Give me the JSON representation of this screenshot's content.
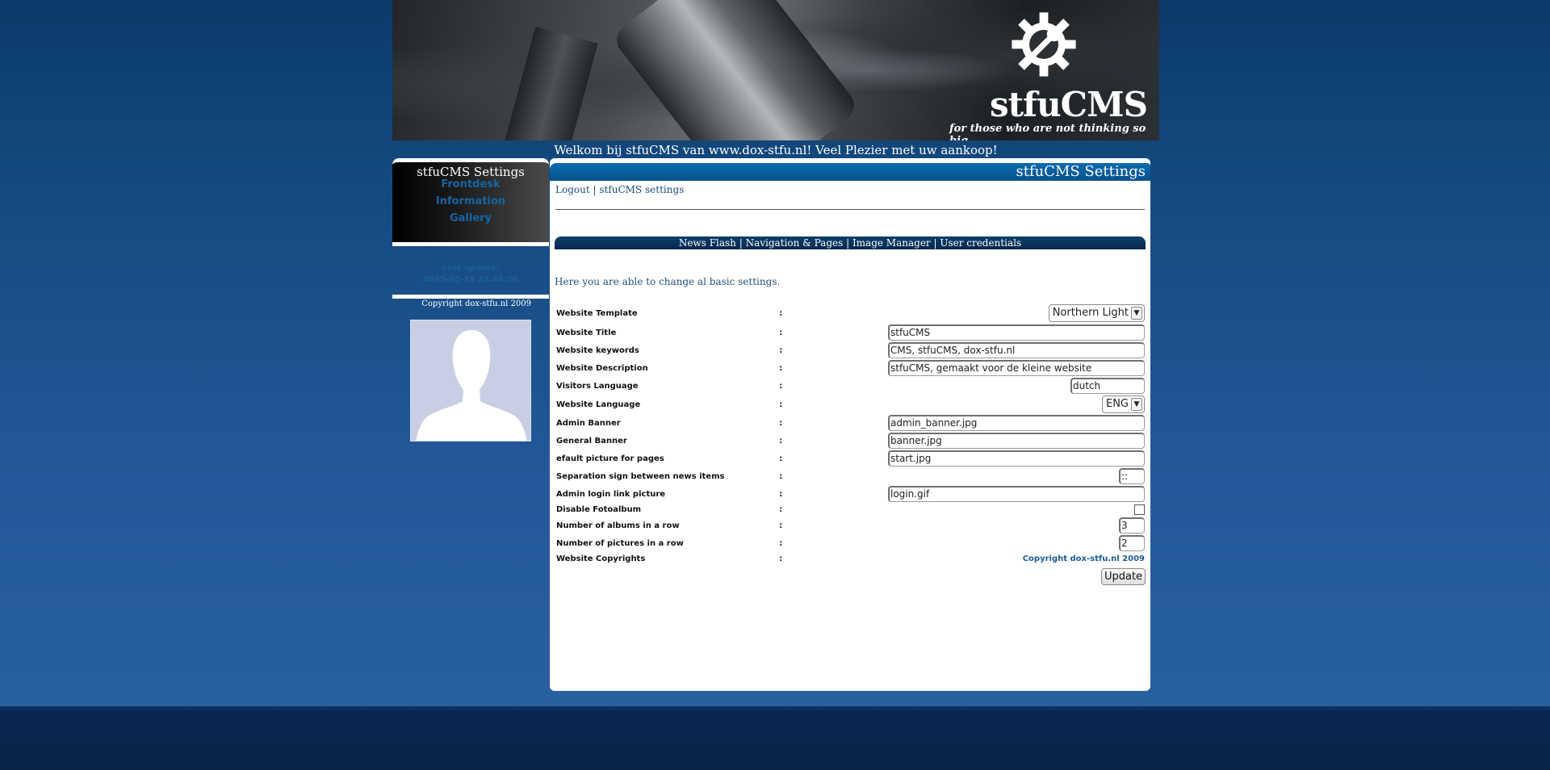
{
  "banner": {
    "logo_name": "stfuCMS",
    "tagline": "for those who are not thinking so big.."
  },
  "welcome": "Welkom bij stfuCMS van www.dox-stfu.nl! Veel Plezier met uw aankoop!",
  "left_menu": {
    "title": "stfuCMS Settings",
    "items": [
      "Frontdesk",
      "Information",
      "Gallery"
    ],
    "last_update_label": "Last update:",
    "last_update_value": "2015-05-18 22:48:20",
    "copyright": "Copyright dox-stfu.nl 2009"
  },
  "main": {
    "header": "stfuCMS Settings",
    "toplinks": {
      "logout": "Logout",
      "sep": " | ",
      "settings": "stfuCMS settings"
    },
    "subnav": [
      "News Flash",
      "Navigation & Pages",
      "Image Manager",
      "User credentials"
    ],
    "subnav_sep": " | ",
    "intro": "Here you are able to change al basic settings.",
    "colon": ":",
    "rows": [
      {
        "label": "Website Template",
        "type": "select",
        "value": "Northern Light"
      },
      {
        "label": "Website Title",
        "type": "text",
        "value": "stfuCMS"
      },
      {
        "label": "Website keywords",
        "type": "text",
        "value": "CMS, stfuCMS, dox-stfu.nl"
      },
      {
        "label": "Website Description",
        "type": "text",
        "value": "stfuCMS, gemaakt voor de kleine website"
      },
      {
        "label": "Visitors Language",
        "type": "text-short",
        "value": "dutch"
      },
      {
        "label": "Website Language",
        "type": "select-short",
        "value": "ENG"
      },
      {
        "label": "Admin Banner",
        "type": "text",
        "value": "admin_banner.jpg"
      },
      {
        "label": "General Banner",
        "type": "text",
        "value": "banner.jpg"
      },
      {
        "label": "efault picture for pages",
        "type": "text",
        "value": "start.jpg"
      },
      {
        "label": "Separation sign between news items",
        "type": "text-tiny",
        "value": "::"
      },
      {
        "label": "Admin login link picture",
        "type": "text",
        "value": "login.gif"
      },
      {
        "label": "Disable Fotoalbum",
        "type": "checkbox",
        "value": ""
      },
      {
        "label": "Number of albums in a row",
        "type": "text-tiny",
        "value": "3"
      },
      {
        "label": "Number of pictures in a row",
        "type": "text-tiny",
        "value": "2"
      },
      {
        "label": "Website Copyrights",
        "type": "static",
        "value": "Copyright dox-stfu.nl 2009"
      }
    ],
    "update_label": "Update"
  }
}
